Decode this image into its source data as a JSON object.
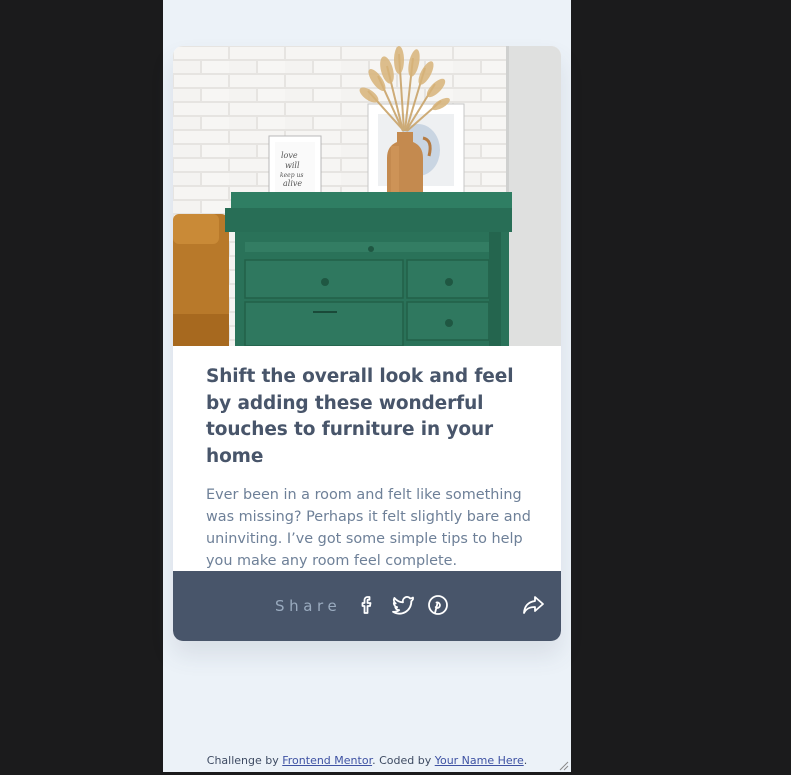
{
  "article": {
    "image_alt": "Green drawers with framed pictures and dried pampas grass in a vase against a white brick wall",
    "title": "Shift the overall look and feel by adding these wonderful touches to furniture in your home",
    "description": "Ever been in a room and felt like something was missing? Perhaps it felt slightly bare and uninviting. I’ve got some simple tips to help you make any room feel complete."
  },
  "share": {
    "label": "Share",
    "icons": [
      "facebook-icon",
      "twitter-icon",
      "pinterest-icon",
      "share-arrow-icon"
    ]
  },
  "attribution": {
    "prefix": "Challenge by ",
    "link1": "Frontend Mentor",
    "middle": ". Coded by ",
    "link2": "Your Name Here",
    "suffix": "."
  },
  "colors": {
    "page_bg": "#ecf2f8",
    "card_bg": "#ffffff",
    "title": "#48556a",
    "description": "#6e8098",
    "share_bar": "#48556a",
    "share_label": "#9aabbf",
    "outer_bg": "#1b1b1c"
  }
}
